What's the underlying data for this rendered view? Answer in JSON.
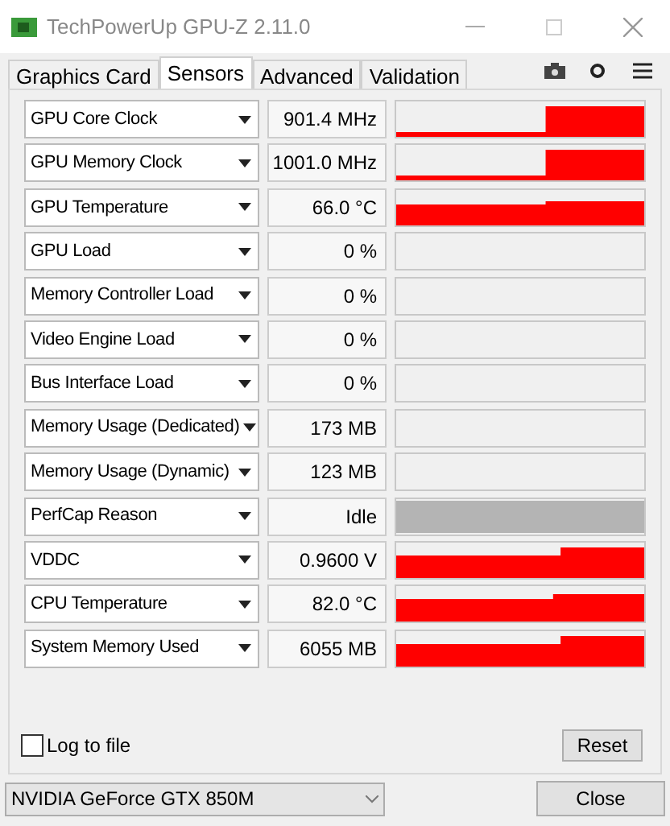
{
  "window": {
    "title": "TechPowerUp GPU-Z 2.11.0"
  },
  "tabs": [
    {
      "label": "Graphics Card",
      "selected": false
    },
    {
      "label": "Sensors",
      "selected": true
    },
    {
      "label": "Advanced",
      "selected": false
    },
    {
      "label": "Validation",
      "selected": false
    }
  ],
  "sensors": [
    {
      "name": "GPU Core Clock",
      "value": "901.4 MHz",
      "kind": "step"
    },
    {
      "name": "GPU Memory Clock",
      "value": "1001.0 MHz",
      "kind": "step"
    },
    {
      "name": "GPU Temperature",
      "value": "66.0 °C",
      "kind": "full"
    },
    {
      "name": "GPU Load",
      "value": "0 %",
      "kind": "empty"
    },
    {
      "name": "Memory Controller Load",
      "value": "0 %",
      "kind": "empty"
    },
    {
      "name": "Video Engine Load",
      "value": "0 %",
      "kind": "empty"
    },
    {
      "name": "Bus Interface Load",
      "value": "0 %",
      "kind": "empty"
    },
    {
      "name": "Memory Usage (Dedicated)",
      "value": "173 MB",
      "kind": "empty"
    },
    {
      "name": "Memory Usage (Dynamic)",
      "value": "123 MB",
      "kind": "empty"
    },
    {
      "name": "PerfCap Reason",
      "value": "Idle",
      "kind": "perfcap"
    },
    {
      "name": "VDDC",
      "value": "0.9600 V",
      "kind": "low"
    },
    {
      "name": "CPU Temperature",
      "value": "82.0 °C",
      "kind": "high"
    },
    {
      "name": "System Memory Used",
      "value": "6055 MB",
      "kind": "low"
    }
  ],
  "log_to_file": {
    "label": "Log to file",
    "checked": false
  },
  "reset_button": "Reset",
  "gpu_select": {
    "value": "NVIDIA GeForce GTX 850M"
  },
  "close_button": "Close"
}
